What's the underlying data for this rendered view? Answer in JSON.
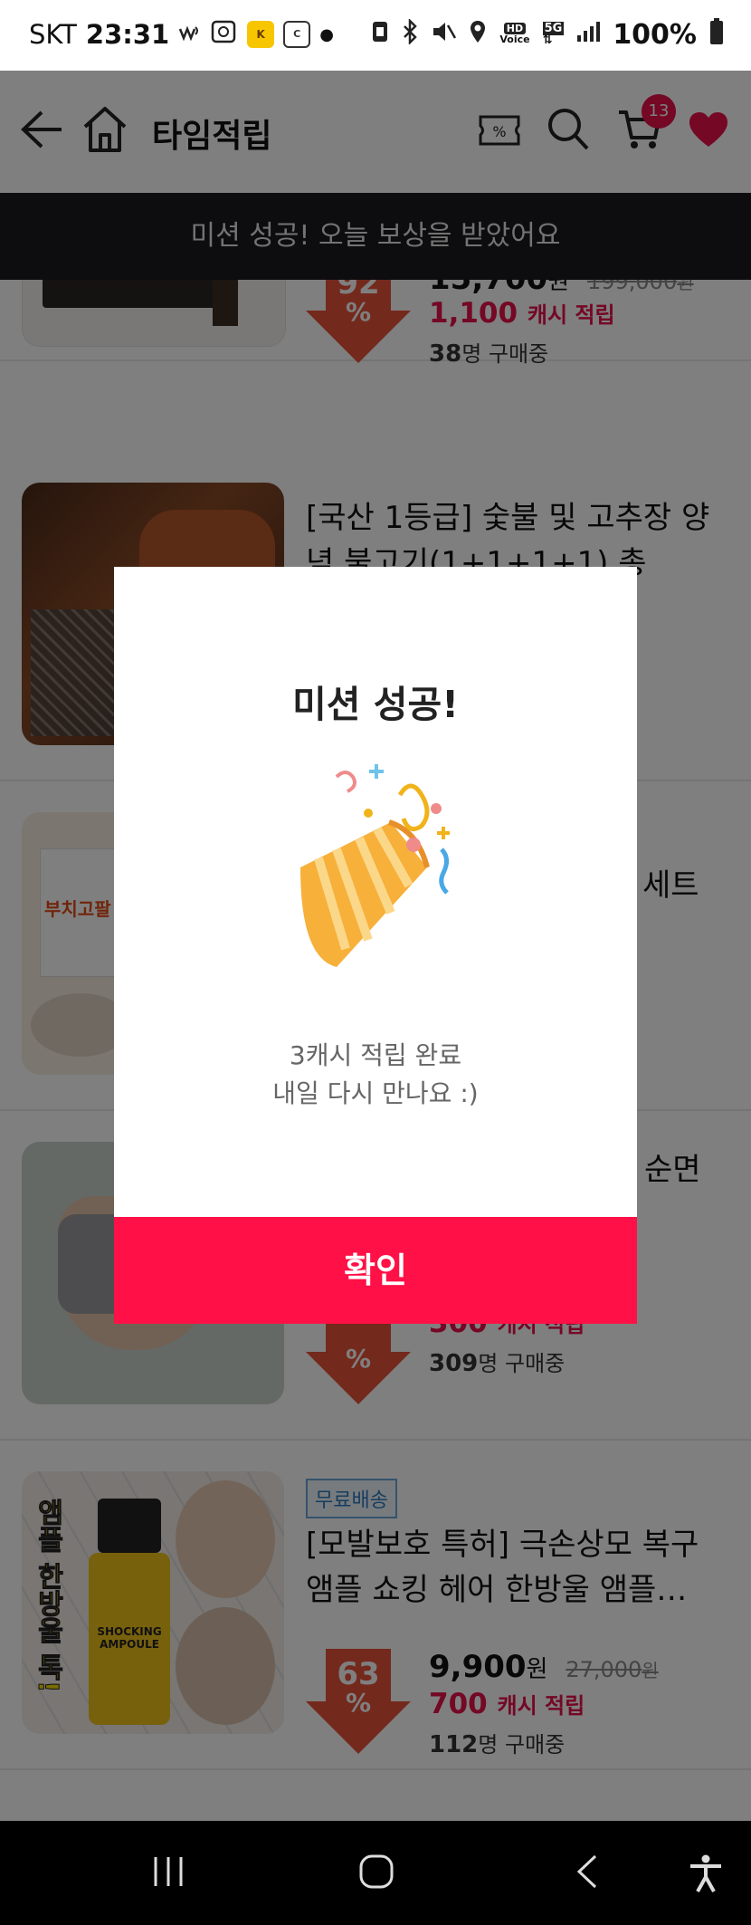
{
  "status_bar": {
    "carrier": "SKT",
    "time": "23:31",
    "battery": "100%",
    "icons": [
      "wifi-calling-icon",
      "notification-app-icon",
      "kakao-icon",
      "cash-app-icon",
      "dot-icon",
      "nfc-icon",
      "bluetooth-icon",
      "mute-icon",
      "location-icon",
      "hd-voice-icon",
      "5g-icon",
      "signal-icon",
      "battery-icon"
    ]
  },
  "header": {
    "title": "타임적립",
    "cart_count": "13"
  },
  "toast": {
    "text": "미션 성공! 오늘 보상을 받았어요"
  },
  "products": [
    {
      "name": "",
      "discount": "92",
      "price": "15,700",
      "currency": "원",
      "original_price": "199,000",
      "cash": "1,100",
      "cash_label": "캐시 적립",
      "buyers": "38",
      "buyers_label": "명 구매중"
    },
    {
      "name": "[국산 1등급] 숯불 및 고추장 양념 불고기(1+1+1+1) 총 1.2kg"
    },
    {
      "name": "세트",
      "thumb_text": "부치고팔"
    },
    {
      "name": "순면",
      "cash": "300",
      "cash_label": "캐시 적립",
      "buyers": "309",
      "buyers_label": "명 구매중"
    },
    {
      "badge": "무료배송",
      "name": "[모발보호 특허] 극손상모 복구 앰플 쇼킹 헤어 한방울 앰플…",
      "discount": "63",
      "price": "9,900",
      "currency": "원",
      "original_price": "27,000",
      "cash": "700",
      "cash_label": "캐시 적립",
      "buyers": "112",
      "buyers_label": "명 구매중",
      "thumb_text": "앰플 한방울 톡!",
      "bottle_text": "SHOCKING AMPOULE"
    }
  ],
  "modal": {
    "title": "미션 성공!",
    "line1": "3캐시 적립 완료",
    "line2": "내일 다시 만나요 :)",
    "confirm": "확인"
  },
  "colors": {
    "accent": "#ff1046",
    "cash": "#e8114a",
    "discount_arrow": "#e8533b"
  }
}
